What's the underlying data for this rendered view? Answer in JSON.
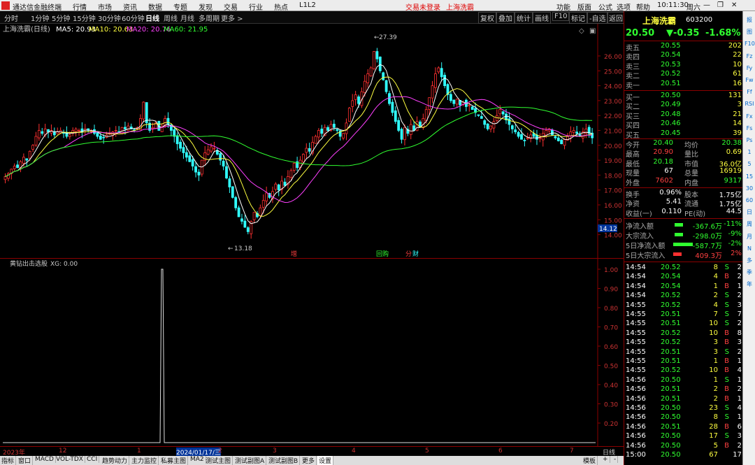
{
  "app": {
    "title": "通达信金融终端",
    "menu": [
      "行情",
      "市场",
      "资讯",
      "数据",
      "专题",
      "发现",
      "交易",
      "行业",
      "热点",
      "L1L2"
    ],
    "login_status": "交易未登录",
    "stock_tag": "上海洗霸",
    "right_menu": [
      "功能",
      "版面",
      "公式",
      "选项",
      "帮助"
    ],
    "time": "10:11:30",
    "weekday": "周六"
  },
  "toolbar": {
    "periods": [
      "分时",
      "1分钟",
      "5分钟",
      "15分钟",
      "30分钟",
      "60分钟",
      "日线",
      "周线",
      "月线",
      "多周期",
      "更多 >"
    ],
    "active": "日线",
    "right": [
      "复权",
      "叠加",
      "统计",
      "画线",
      "F10",
      "标记",
      "-自选",
      "返回"
    ]
  },
  "chart": {
    "title": "上海洗霸(日线)",
    "ma": [
      {
        "label": "MA5: 20.93",
        "color": "#ffffff"
      },
      {
        "label": "MA10: 20.63",
        "color": "#ffff40"
      },
      {
        "label": "MA20: 20.76",
        "color": "#ff40ff"
      },
      {
        "label": "MA60: 21.95",
        "color": "#30ff30"
      }
    ],
    "ylabels": [
      "26.00",
      "25.00",
      "24.00",
      "23.00",
      "22.00",
      "21.00",
      "20.00",
      "19.00",
      "18.00",
      "17.00",
      "16.00",
      "15.00",
      "14.00"
    ],
    "high_label": "27.39",
    "low_label": "13.18",
    "cursor_price": "14.12",
    "markers": [
      {
        "text": "增",
        "color": "#ff4040"
      },
      {
        "text": "回购",
        "color": "#30ff30"
      },
      {
        "text": "分",
        "color": "#ff4040"
      },
      {
        "text": "财",
        "color": "#30ffff"
      }
    ]
  },
  "chart_data": {
    "type": "candlestick",
    "indicator": {
      "title": "黄钻出击选股",
      "label": "XG: 0.00",
      "ylabels": [
        "1.00",
        "0.90",
        "0.80",
        "0.70",
        "0.60",
        "0.50",
        "0.40",
        "0.30",
        "0.20"
      ]
    }
  },
  "dates": {
    "labels": [
      "2023年",
      "12",
      "1",
      "2024/01/17/三",
      "2",
      "3",
      "4",
      "5",
      "6",
      "7"
    ],
    "right": "日线"
  },
  "bottom": {
    "tabs": [
      "指标",
      "窗口",
      "MACD",
      "VOL-TDX",
      "CCI",
      "趋势动力",
      "主力监控",
      "私募主图",
      "MA2",
      "测试主图",
      "测试副图A",
      "测试副图B",
      "更多",
      "设置"
    ],
    "right": [
      "模板",
      "+",
      "-"
    ]
  },
  "quote": {
    "name": "上海洗霸",
    "code": "603200",
    "price": "20.50",
    "change": "▼-0.35",
    "pct": "-1.68%",
    "asks": [
      [
        "卖五",
        "20.55",
        "202"
      ],
      [
        "卖四",
        "20.54",
        "22"
      ],
      [
        "卖三",
        "20.53",
        "10"
      ],
      [
        "卖二",
        "20.52",
        "61"
      ],
      [
        "卖一",
        "20.51",
        "16"
      ]
    ],
    "bids": [
      [
        "买一",
        "20.50",
        "131"
      ],
      [
        "买二",
        "20.49",
        "3"
      ],
      [
        "买三",
        "20.48",
        "21"
      ],
      [
        "买四",
        "20.46",
        "14"
      ],
      [
        "买五",
        "20.45",
        "39"
      ]
    ],
    "stats": [
      [
        "今开",
        "20.40",
        "均价",
        "20.38"
      ],
      [
        "最高",
        "20.90",
        "量比",
        "0.69"
      ],
      [
        "最低",
        "20.18",
        "市值",
        "36.0亿"
      ],
      [
        "现量",
        "67",
        "总量",
        "16919"
      ],
      [
        "外盘",
        "7602",
        "内盘",
        "9317"
      ]
    ],
    "stats2": [
      [
        "换手",
        "0.96%",
        "股本",
        "1.75亿"
      ],
      [
        "净资",
        "5.41",
        "流通",
        "1.75亿"
      ],
      [
        "收益(一)",
        "0.110",
        "PE(动)",
        "44.5"
      ]
    ],
    "flows": [
      [
        "净流入额",
        "-367.6万",
        "-11%"
      ],
      [
        "大宗流入",
        "-298.0万",
        "-9%"
      ],
      [
        "5日净流入额",
        "-587.7万",
        "-2%"
      ],
      [
        "5日大宗流入",
        "409.3万",
        "2%"
      ]
    ],
    "ticks": [
      [
        "14:54",
        "20.52",
        "8",
        "S",
        "2"
      ],
      [
        "14:54",
        "20.54",
        "4",
        "B",
        "2"
      ],
      [
        "14:54",
        "20.54",
        "1",
        "B",
        "1"
      ],
      [
        "14:54",
        "20.52",
        "2",
        "S",
        "2"
      ],
      [
        "14:55",
        "20.52",
        "4",
        "S",
        "3"
      ],
      [
        "14:55",
        "20.51",
        "7",
        "S",
        "7"
      ],
      [
        "14:55",
        "20.51",
        "10",
        "S",
        "2"
      ],
      [
        "14:55",
        "20.52",
        "10",
        "B",
        "8"
      ],
      [
        "14:55",
        "20.52",
        "3",
        "B",
        "3"
      ],
      [
        "14:55",
        "20.51",
        "3",
        "S",
        "2"
      ],
      [
        "14:55",
        "20.51",
        "1",
        "B",
        "1"
      ],
      [
        "14:55",
        "20.52",
        "10",
        "B",
        "4"
      ],
      [
        "14:56",
        "20.50",
        "1",
        "S",
        "1"
      ],
      [
        "14:56",
        "20.51",
        "2",
        "B",
        "2"
      ],
      [
        "14:56",
        "20.51",
        "2",
        "B",
        "1"
      ],
      [
        "14:56",
        "20.50",
        "23",
        "S",
        "4"
      ],
      [
        "14:56",
        "20.50",
        "8",
        "S",
        "1"
      ],
      [
        "14:56",
        "20.51",
        "28",
        "B",
        "6"
      ],
      [
        "14:56",
        "20.50",
        "17",
        "S",
        "3"
      ],
      [
        "14:56",
        "20.50",
        "5",
        "B",
        "2"
      ],
      [
        "15:00",
        "20.50",
        "67",
        "",
        "17"
      ]
    ]
  },
  "side_tools": [
    "报",
    "图",
    "F10",
    "Fz",
    "Fy",
    "Fw",
    "Ff",
    "RSI",
    "Fx",
    "Fs",
    "Ps",
    "1",
    "5",
    "15",
    "30",
    "60",
    "日",
    "周",
    "月",
    "N",
    "多",
    "季",
    "年"
  ]
}
